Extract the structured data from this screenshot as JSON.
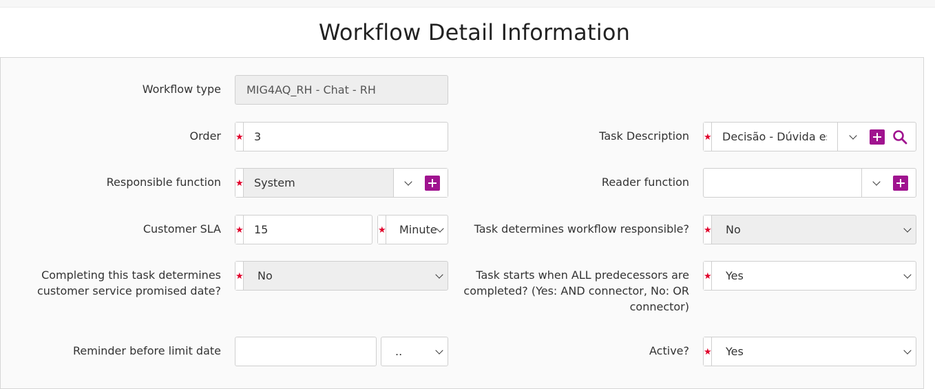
{
  "page": {
    "title": "Workflow Detail Information"
  },
  "form": {
    "workflow_type": {
      "label": "Workflow type",
      "value": "MIG4AQ_RH - Chat - RH"
    },
    "order": {
      "label": "Order",
      "value": "3"
    },
    "task_description": {
      "label": "Task Description",
      "value": "Decisão - Dúvida esc"
    },
    "responsible_function": {
      "label": "Responsible function",
      "value": "System"
    },
    "reader_function": {
      "label": "Reader function",
      "value": ""
    },
    "customer_sla": {
      "label": "Customer SLA",
      "value": "15",
      "unit": "Minute"
    },
    "task_determines_responsible": {
      "label": "Task determines workflow responsible?",
      "value": "No"
    },
    "completing_determines_date": {
      "label_line1": "Completing this task determines",
      "label_line2": "customer service promised date?",
      "value": "No"
    },
    "task_starts_all_predecessors": {
      "label_line1": "Task starts when ALL predecessors are",
      "label_line2": "completed? (Yes: AND connector, No: OR",
      "label_line3": "connector)",
      "value": "Yes"
    },
    "reminder_before_limit": {
      "label": "Reminder before limit date",
      "value": "",
      "unit": ".."
    },
    "active": {
      "label": "Active?",
      "value": "Yes"
    }
  },
  "colors": {
    "accent": "#a0138f",
    "required": "#e0002a"
  }
}
